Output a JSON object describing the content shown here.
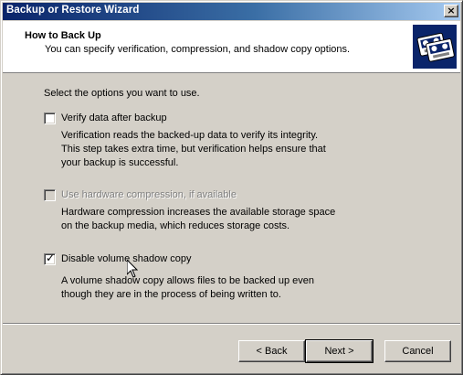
{
  "window": {
    "title": "Backup or Restore Wizard",
    "close_label": "×"
  },
  "header": {
    "title": "How to Back Up",
    "subtitle": "You can specify verification, compression, and shadow copy options.",
    "icon": "backup-tapes-icon"
  },
  "main": {
    "intro": "Select the options you want to use.",
    "options": [
      {
        "label": "Verify data after backup",
        "checked": false,
        "enabled": true,
        "description": [
          "Verification reads the backed-up data to verify its integrity.",
          "This step takes extra time, but verification helps ensure that",
          "your backup is successful."
        ]
      },
      {
        "label": "Use hardware compression, if available",
        "checked": false,
        "enabled": false,
        "description": [
          "Hardware compression increases the available storage space",
          "on the backup media, which reduces storage costs."
        ]
      },
      {
        "label": "Disable volume shadow copy",
        "checked": true,
        "enabled": true,
        "description": [
          "A volume shadow copy allows files to be backed up even",
          "though they are in the process of being written to."
        ]
      }
    ]
  },
  "buttons": {
    "back": "< Back",
    "next": "Next >",
    "cancel": "Cancel"
  },
  "colors": {
    "titlebar_start": "#0a246a",
    "titlebar_end": "#a6caf0",
    "face": "#d4d0c8"
  }
}
